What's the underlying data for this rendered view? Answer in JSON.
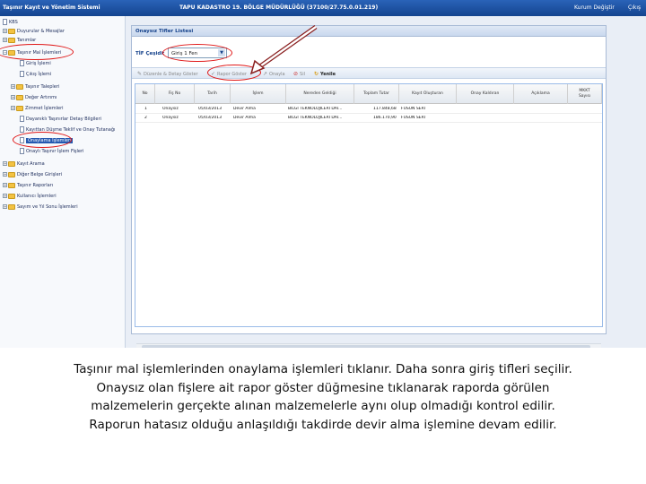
{
  "app": {
    "title": "Taşınır Kayıt ve Yönetim Sistemi",
    "center_title": "TAPU KADASTRO 19. BÖLGE MÜDÜRLÜĞÜ (37100/27.75.0.01.219)",
    "switch_institution": "Kurum Değiştir",
    "logout": "Çıkış"
  },
  "sidebar": {
    "items": [
      {
        "label": "KBS"
      },
      {
        "label": "Duyurular & Mesajlar"
      },
      {
        "label": "Tanımlar"
      },
      {
        "label": "Taşınır Mal İşlemleri"
      },
      {
        "label": "Giriş İşlemi"
      },
      {
        "label": "Çıkış İşlemi"
      },
      {
        "label": "Taşınır Talepleri"
      },
      {
        "label": "Değer Artırımı"
      },
      {
        "label": "Zimmet İşlemleri"
      },
      {
        "label": "Dayanıklı Taşınırlar Detay Bilgileri"
      },
      {
        "label": "Kayıttan Düşme Teklif ve Onay Tutanağı"
      },
      {
        "label": "Onaylama İşlemleri"
      },
      {
        "label": "Onaylı Taşınır İşlem Fişleri"
      },
      {
        "label": "Kayıt Arama"
      },
      {
        "label": "Diğer Belge Girişleri"
      },
      {
        "label": "Taşınır Raporları"
      },
      {
        "label": "Kullanıcı İşlemleri"
      },
      {
        "label": "Sayım ve Yıl Sonu İşlemleri"
      }
    ]
  },
  "panel": {
    "title": "Onaysız Tifler Listesi",
    "tif_label": "TİF Çeşidi:",
    "tif_value": "Giriş 1 Fen"
  },
  "toolbar": {
    "detail_label": "Düzenle & Detay Göster",
    "report_label": "Rapor Göster",
    "approve_label": "Onayla",
    "delete_label": "Sil",
    "refresh_label": "Yenile"
  },
  "grid": {
    "headers": [
      "No",
      "Fiş No",
      "Tarih",
      "İşlem",
      "Nereden Geldiği",
      "Toplam Tutar",
      "Kayıt Oluşturan",
      "Onay Kaldıran",
      "Açıklama",
      "MKKT Sayısı"
    ],
    "rows": [
      [
        "1",
        "Onaysız",
        "05/03/2013",
        "Devir Alma",
        "BİLGİ TEKNOLOJİLERİ DAİ...",
        "117.848,68",
        "FÜSUN SERT",
        "",
        "",
        ""
      ],
      [
        "2",
        "Onaysız",
        "05/03/2013",
        "Devir Alma",
        "BİLGİ TEKNOLOJİLERİ DAİ...",
        "186.170,90",
        "FÜSUN SERT",
        "",
        "",
        ""
      ]
    ]
  },
  "caption": {
    "line1": "Taşınır mal işlemlerinden onaylama işlemleri tıklanır. Daha sonra giriş tifleri seçilir.",
    "line2": "Onaysız olan fişlere ait rapor göster düğmesine tıklanarak raporda görülen",
    "line3": "malzemelerin gerçekte alınan malzemelerle aynı olup olmadığı kontrol edilir.",
    "line4": "Raporun hatasız olduğu anlaşıldığı takdirde devir alma işlemine devam edilir."
  },
  "colors": {
    "topbar": "#1f56a8",
    "highlight": "#e01818",
    "selected": "#2458b0"
  }
}
